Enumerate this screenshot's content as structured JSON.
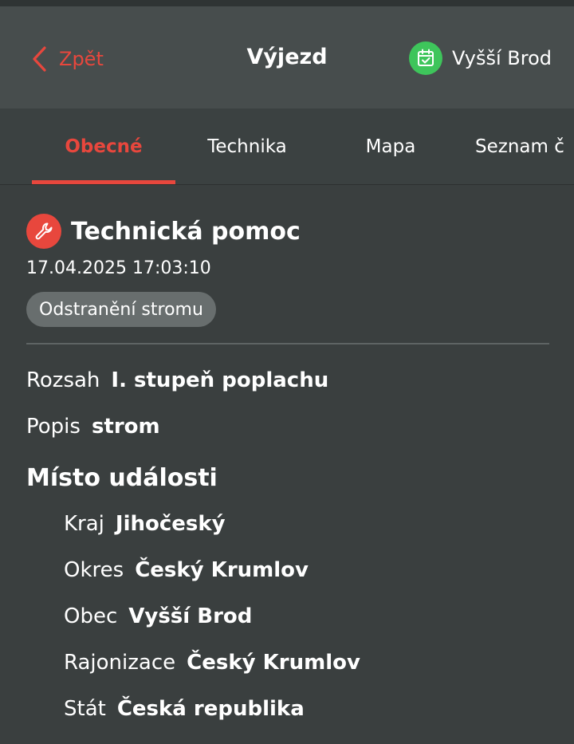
{
  "header": {
    "back_label": "Zpět",
    "title": "Výjezd",
    "unit_label": "Vyšší Brod",
    "accent_color": "#e8473d",
    "unit_badge_color": "#3ec55b"
  },
  "tabs": [
    {
      "label": "Obecné",
      "active": true
    },
    {
      "label": "Technika",
      "active": false
    },
    {
      "label": "Mapa",
      "active": false
    },
    {
      "label": "Seznam č",
      "active": false
    }
  ],
  "event": {
    "type_title": "Technická pomoc",
    "datetime": "17.04.2025 17:03:10",
    "tag": "Odstranění stromu"
  },
  "details": {
    "rozsah": {
      "key": "Rozsah",
      "value": "I. stupeň poplachu"
    },
    "popis": {
      "key": "Popis",
      "value": "strom"
    }
  },
  "location": {
    "section_title": "Místo události",
    "kraj": {
      "key": "Kraj",
      "value": "Jihočeský"
    },
    "okres": {
      "key": "Okres",
      "value": "Český Krumlov"
    },
    "obec": {
      "key": "Obec",
      "value": "Vyšší Brod"
    },
    "rajonizace": {
      "key": "Rajonizace",
      "value": "Český Krumlov"
    },
    "stat": {
      "key": "Stát",
      "value": "Česká republika"
    }
  },
  "icons": {
    "back": "chevron-left-icon",
    "unit": "calendar-check-icon",
    "event": "wrench-icon"
  }
}
